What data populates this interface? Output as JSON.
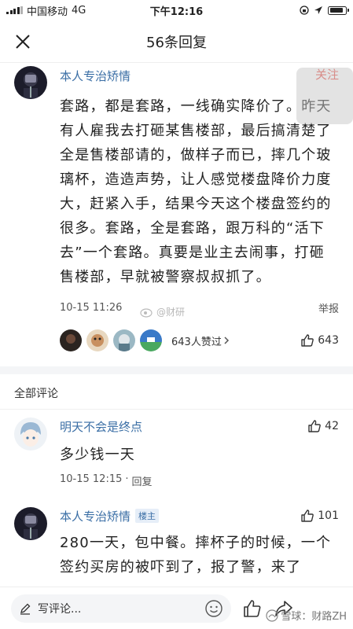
{
  "status_bar": {
    "carrier": "中国移动",
    "network": "4G",
    "time": "下午12:16"
  },
  "nav": {
    "title": "56条回复"
  },
  "post": {
    "author": "本人专治矫情",
    "follow_label": "关注",
    "body": "套路，都是套路，一线确实降价了。昨天有人雇我去打砸某售楼部，最后搞清楚了全是售楼部请的，做样子而已，摔几个玻璃杯，造造声势，让人感觉楼盘降价力度大，赶紧入手，结果今天这个楼盘签约的很多。套路，全是套路，跟万科的“活下去”一个套路。真要是业主去闹事，打砸售楼部，早就被警察叔叔抓了。",
    "time": "10-15 11:26",
    "report_label": "举报",
    "likes_text": "643人赞过",
    "like_count": "643"
  },
  "comments_section": {
    "title": "全部评论"
  },
  "comments": [
    {
      "author": "明天不会是终点",
      "badge": "",
      "like_count": "42",
      "body": "多少钱一天",
      "time": "10-15 12:15",
      "reply_label": "回复"
    },
    {
      "author": "本人专治矫情",
      "badge": "楼主",
      "like_count": "101",
      "body": "280一天，包中餐。摔杯子的时候，一个签约买房的被吓到了，报了警，来了"
    }
  ],
  "bottom_bar": {
    "input_placeholder": "写评论..."
  },
  "watermarks": {
    "mid": "@财研",
    "bottom": "雪球：财路ZH"
  },
  "colors": {
    "link_blue": "#3a6ea5",
    "follow_red": "#e8534a",
    "section_bg": "#f4f5f7"
  },
  "icons": [
    "close-icon",
    "thumb-up-icon",
    "chevron-right-icon",
    "pencil-icon",
    "emoji-icon",
    "share-icon"
  ]
}
